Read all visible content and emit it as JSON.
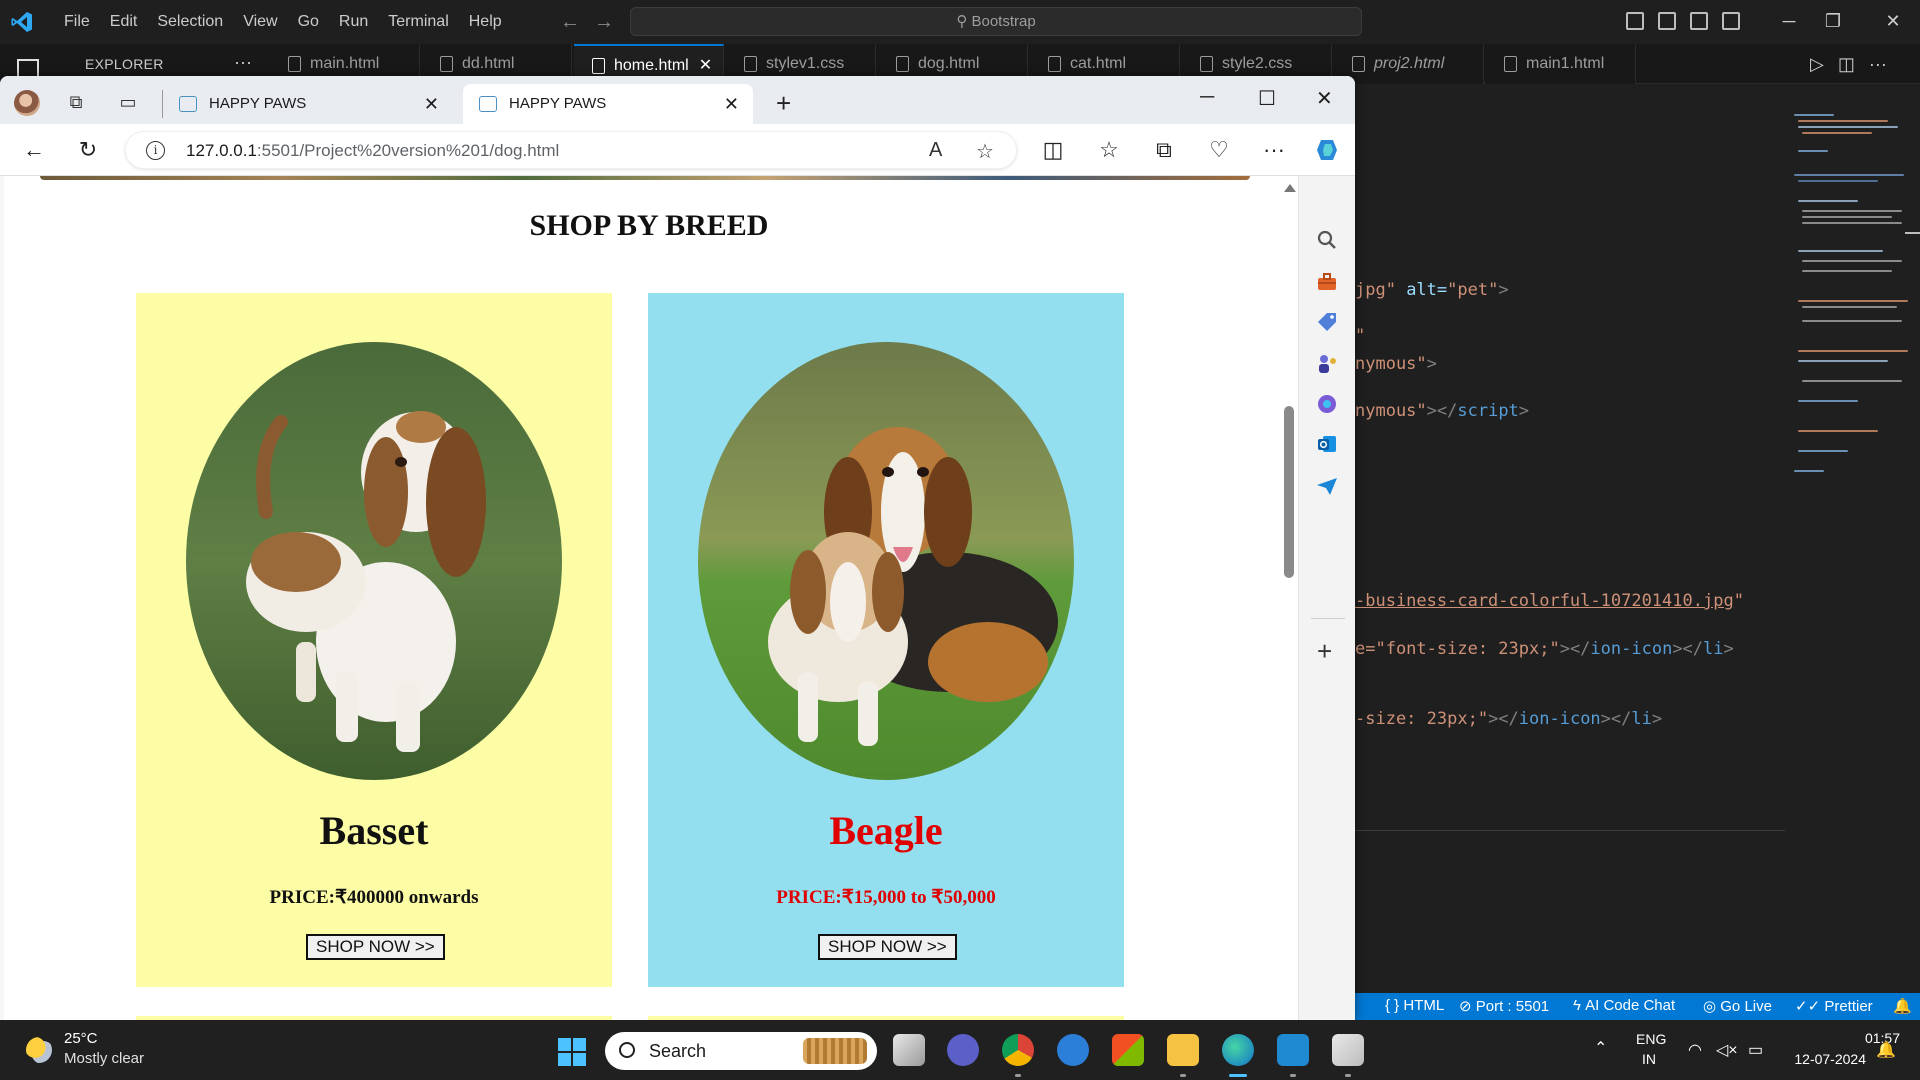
{
  "vscode": {
    "menus": [
      "File",
      "Edit",
      "Selection",
      "View",
      "Go",
      "Run",
      "Terminal",
      "Help"
    ],
    "command_center": "Bootstrap",
    "explorer_label": "EXPLORER",
    "tabs": [
      {
        "label": "main.html"
      },
      {
        "label": "dd.html"
      },
      {
        "label": "home.html",
        "active": true
      },
      {
        "label": "stylev1.css"
      },
      {
        "label": "dog.html"
      },
      {
        "label": "cat.html"
      },
      {
        "label": "style2.css"
      },
      {
        "label": "proj2.html",
        "italic": true
      },
      {
        "label": "main1.html"
      }
    ],
    "code": {
      "l1_str": "jpg\"",
      "l1_attr": " alt=",
      "l1_val": "\"pet\"",
      "l1_end": ">",
      "l2_str": "\"",
      "l3_str": "nymous\"",
      "l3_end": ">",
      "l4_str": "nymous\"",
      "l4_tag": "></",
      "l4_name": "script",
      "l4_end": ">",
      "l5_link": "-business-card-colorful-107201410.jpg",
      "l5_end": "\"",
      "l6_str": "e=\"font-size: 23px;\"",
      "l6_tag": "></",
      "l6_name": "ion-icon",
      "l6_tag2": "></",
      "l6_name2": "li",
      "l6_end": ">",
      "l7_str": "-size: 23px;\"",
      "l7_tag": "></",
      "l7_name": "ion-icon",
      "l7_tag2": "></",
      "l7_name2": "li",
      "l7_end": ">"
    },
    "status": {
      "lang": "HTML",
      "port": "Port : 5501",
      "ai": "AI Code Chat",
      "golive": "Go Live",
      "prettier": "Prettier"
    }
  },
  "edge": {
    "tabs": [
      {
        "title": "HAPPY PAWS"
      },
      {
        "title": "HAPPY PAWS",
        "active": true
      }
    ],
    "url_host": "127.0.0.1",
    "url_rest": ":5501/Project%20version%201/dog.html"
  },
  "page": {
    "heading": "SHOP BY BREED",
    "cards": [
      {
        "name": "Basset",
        "price": "PRICE:₹400000 onwards",
        "button": "SHOP NOW >>",
        "bg": "#fdfda6",
        "text_color": "#111111"
      },
      {
        "name": "Beagle",
        "price": "PRICE:₹15,000 to ₹50,000",
        "button": "SHOP NOW >>",
        "bg": "#93dfef",
        "text_color": "#e00000"
      }
    ]
  },
  "taskbar": {
    "temperature": "25°C",
    "weather": "Mostly clear",
    "search_placeholder": "Search",
    "lang_top": "ENG",
    "lang_bottom": "IN",
    "time": "01:57",
    "date": "12-07-2024"
  },
  "colors": {
    "vscode_accent": "#0078d4",
    "taskbar_bg": "#202020"
  }
}
